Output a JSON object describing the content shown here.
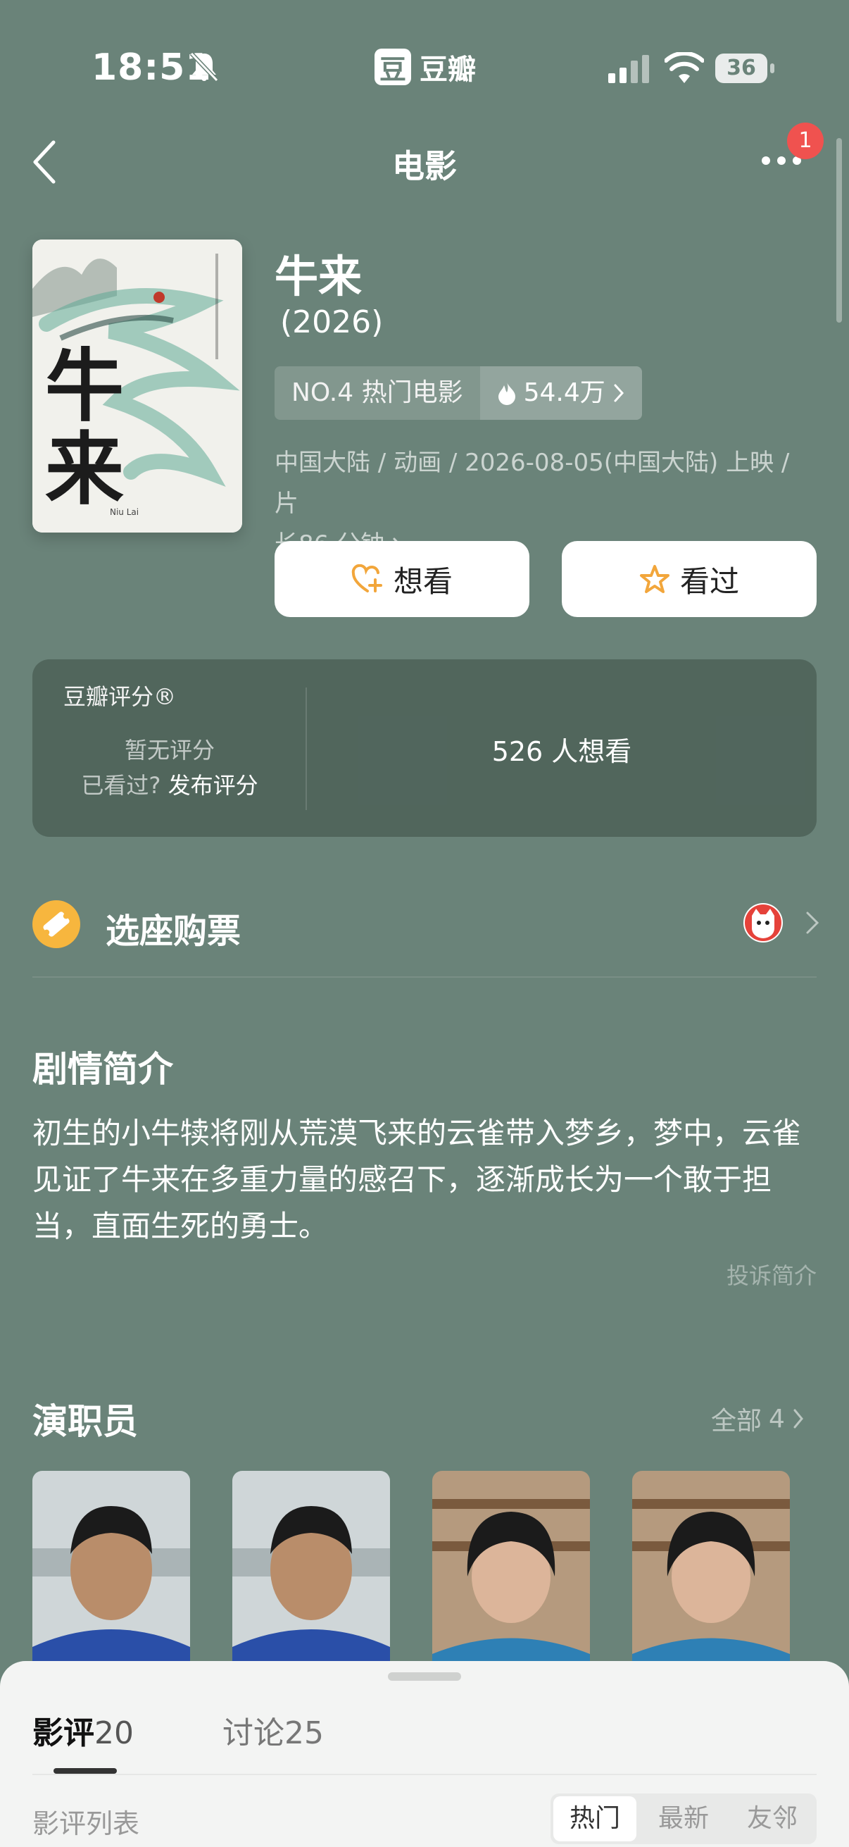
{
  "status_bar": {
    "time": "18:51",
    "app_logo_char": "豆",
    "app_name": "豆瓣",
    "battery": "36"
  },
  "nav": {
    "title": "电影",
    "notification_count": "1"
  },
  "movie": {
    "title": "牛来",
    "year": "(2026)",
    "rank": "NO.4 热门电影",
    "hot_count": "54.4万",
    "meta_line1": "中国大陆 / 动画 / 2026-08-05(中国大陆) 上映 / 片",
    "meta_line2": "长86 分钟",
    "want_label": "想看",
    "seen_label": "看过",
    "poster": {
      "title_chars": [
        "牛",
        "来"
      ],
      "subtitle": "Niu Lai"
    }
  },
  "rating": {
    "label": "豆瓣评分®",
    "no_rating": "暂无评分",
    "seen_prompt": "已看过?",
    "publish_link": "发布评分",
    "want_count": "526 人想看"
  },
  "tickets": {
    "label": "选座购票"
  },
  "synopsis": {
    "title": "剧情简介",
    "text": "初生的小牛犊将刚从荒漠飞来的云雀带入梦乡，梦中，云雀见证了牛来在多重力量的感召下，逐渐成长为一个敢于担当，直面生死的勇士。",
    "report": "投诉简介"
  },
  "cast": {
    "title": "演职员",
    "all_label": "全部",
    "all_count": "4"
  },
  "sheet": {
    "tab_review": "影评",
    "tab_review_count": "20",
    "tab_discussion": "讨论",
    "tab_discussion_count": "25",
    "list_label": "影评列表",
    "filters": [
      "热门",
      "最新",
      "友邻"
    ]
  },
  "colors": {
    "background": "#6a8379",
    "accent_orange": "#f7b63e",
    "badge_red": "#f0524f"
  }
}
